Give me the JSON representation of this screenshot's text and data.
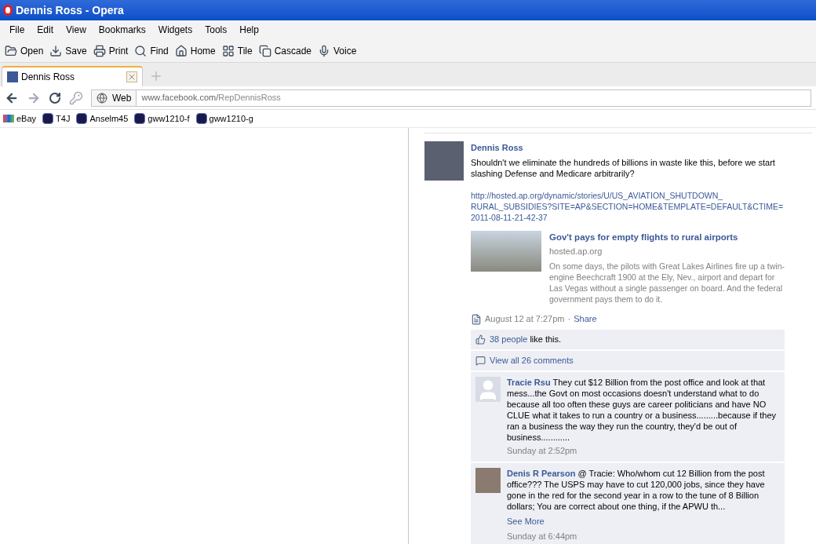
{
  "window": {
    "title": "Dennis Ross - Opera"
  },
  "menu": [
    "File",
    "Edit",
    "View",
    "Bookmarks",
    "Widgets",
    "Tools",
    "Help"
  ],
  "toolbar": [
    {
      "kind": "open",
      "label": "Open"
    },
    {
      "kind": "save",
      "label": "Save"
    },
    {
      "kind": "print",
      "label": "Print"
    },
    {
      "kind": "find",
      "label": "Find"
    },
    {
      "kind": "home",
      "label": "Home"
    },
    {
      "kind": "tile",
      "label": "Tile"
    },
    {
      "kind": "cascade",
      "label": "Cascade"
    },
    {
      "kind": "voice",
      "label": "Voice"
    }
  ],
  "tabs": [
    {
      "label": "Dennis Ross",
      "selected": true
    }
  ],
  "address_bar": {
    "scope": "Web",
    "host": "www.facebook.com/",
    "path": "RepDennisRoss"
  },
  "bookmarks": [
    {
      "kind": "ebay",
      "label": "eBay"
    },
    {
      "kind": "site",
      "label": "T4J"
    },
    {
      "kind": "site",
      "label": "Anselm45"
    },
    {
      "kind": "site",
      "label": "gww1210-f"
    },
    {
      "kind": "site",
      "label": "gww1210-g"
    }
  ],
  "post": {
    "author": "Dennis Ross",
    "message": "Shouldn't we eliminate the hundreds of billions in waste like this, before we start slashing Defense and Medicare arbitrarily?",
    "url_lines": [
      "http://hosted.ap.org/dynamic/stories/U/US_AVIATION_SHUTDOWN_",
      "RURAL_SUBSIDIES?SITE=AP&SECTION=HOME&TEMPLATE=DEFAULT&CTIME=",
      "2011-08-11-21-42-37"
    ],
    "attachment": {
      "title": "Gov't pays for empty flights to rural airports",
      "source": "hosted.ap.org",
      "summary": "On some days, the pilots with Great Lakes Airlines fire up a twin-engine Beechcraft 1900 at the Ely, Nev., airport and depart for Las Vegas without a single passenger on board. And the federal government pays them to do it."
    },
    "time": "August 12 at 7:27pm",
    "separator": "·",
    "share": "Share",
    "likes_link": "38 people",
    "likes_rest": " like this.",
    "view_comments": "View all 26 comments",
    "comments": [
      {
        "author": "Tracie Rsu",
        "kind": "silhouette",
        "text": " They cut $12 Billion from the post office and look at that mess...the Govt on most occasions doesn't understand what to do because all too often these guys are career politicians and have NO CLUE what it takes to run a country or a business.........because if they ran a business the way they run the country, they'd be out of business............",
        "time": "Sunday at 2:52pm"
      },
      {
        "author": "Denis R Pearson",
        "kind": "photo",
        "text": " @ Tracie: Who/whom cut 12 Billion from the post office??? The USPS may have to cut 120,000 jobs, since they have gone in the red for the second year in a row to the tune of 8 Billion dollars; You are correct about one thing, if the APWU th...",
        "see_more": "See More",
        "time": "Sunday at 6:44pm"
      }
    ]
  }
}
